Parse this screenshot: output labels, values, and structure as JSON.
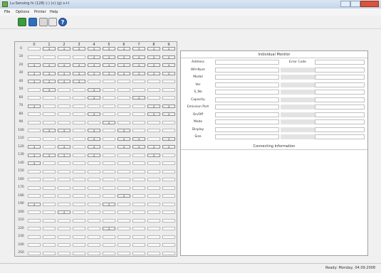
{
  "window": {
    "title": "Lu-Sensing hi (128) (-) (c) (g) s-l-l",
    "app_icon": "app-icon"
  },
  "menu": [
    "File",
    "Options",
    "Printer",
    "Help"
  ],
  "toolbar": [
    "new-icon",
    "save-icon",
    "print-icon",
    "preview-icon",
    "help-icon"
  ],
  "grid": {
    "col_headers": [
      "0",
      "1",
      "2",
      "3",
      "4",
      "5",
      "6",
      "7",
      "8",
      "9"
    ],
    "row_labels": [
      "0",
      "10",
      "20",
      "30",
      "40",
      "50",
      "60",
      "70",
      "80",
      "90",
      "100",
      "110",
      "120",
      "130",
      "140",
      "150",
      "160",
      "170",
      "180",
      "190",
      "200",
      "210",
      "220",
      "230",
      "240",
      "250"
    ],
    "rows": [
      [
        " ",
        "1",
        "1",
        "1",
        "1",
        "1",
        "1",
        "1",
        "1",
        "1"
      ],
      [
        " ",
        "",
        "",
        "",
        "1",
        "1",
        "1",
        "1",
        "1",
        "1"
      ],
      [
        "1",
        "1",
        "1",
        "1",
        "1",
        "1",
        "1",
        "1",
        "1",
        "1"
      ],
      [
        "1",
        "1",
        "1",
        "1",
        "1",
        "1",
        "1",
        "1",
        "1",
        "1"
      ],
      [
        "1",
        "1",
        "1",
        "1",
        "",
        "",
        "",
        "",
        "",
        ""
      ],
      [
        "",
        "1",
        "",
        "",
        "1",
        "",
        "",
        "",
        "",
        ""
      ],
      [
        "",
        "",
        "",
        "",
        "1",
        "",
        "",
        "1",
        "",
        ""
      ],
      [
        "1",
        "",
        "",
        "",
        "",
        "",
        "",
        "",
        "1",
        "1"
      ],
      [
        "",
        "",
        "",
        "",
        "1",
        "",
        "",
        "",
        "1",
        "1"
      ],
      [
        "",
        "",
        "",
        "",
        "",
        "1",
        "",
        "",
        "",
        ""
      ],
      [
        "",
        "1",
        "1",
        "",
        "1",
        "",
        "1",
        "",
        "",
        ""
      ],
      [
        "",
        "",
        "",
        "",
        "1",
        "",
        "1",
        "1",
        "",
        "1"
      ],
      [
        "1",
        "",
        "1",
        "",
        "1",
        "",
        "1",
        "1",
        "1",
        "1"
      ],
      [
        "1",
        "1",
        "1",
        "",
        "1",
        "",
        "",
        "",
        "1",
        ""
      ],
      [
        "1",
        "",
        "",
        "",
        "",
        "",
        "",
        "",
        "",
        ""
      ],
      [
        "",
        "",
        "",
        "",
        "",
        "",
        "",
        "",
        "",
        ""
      ],
      [
        "",
        "",
        "",
        "",
        "",
        "",
        "",
        "",
        "",
        ""
      ],
      [
        "",
        "",
        "",
        "",
        "",
        "",
        "",
        "",
        "",
        ""
      ],
      [
        "",
        "",
        "",
        "",
        "",
        "",
        "1",
        "",
        "",
        ""
      ],
      [
        "1",
        "",
        "",
        "",
        "",
        "1",
        "",
        "",
        "",
        ""
      ],
      [
        "",
        "",
        "1",
        "",
        "",
        "",
        "",
        "",
        "",
        ""
      ],
      [
        "",
        "",
        "",
        "",
        "",
        "",
        "",
        "",
        "",
        ""
      ],
      [
        "",
        "",
        "",
        "",
        "",
        "1",
        "",
        "",
        "",
        ""
      ],
      [
        "",
        "",
        "",
        "",
        "",
        "",
        "",
        "",
        "",
        ""
      ],
      [
        "",
        "",
        "",
        "",
        "",
        "",
        "",
        "",
        "",
        ""
      ],
      [
        "",
        "",
        "",
        "",
        "",
        "",
        "",
        "",
        "",
        ""
      ]
    ]
  },
  "details": {
    "title": "Individual Monitor",
    "fields": [
      "Address",
      "WH-Num",
      "Model",
      "Ver",
      "S_No",
      "Capacity",
      "Emission Port",
      "On/Off",
      "Mode",
      "Display",
      "Size"
    ],
    "side_label": "Error Code"
  },
  "connecting": {
    "title": "Connecting Information"
  },
  "status": {
    "text": "Ready: Monday, 04.09.2008"
  }
}
